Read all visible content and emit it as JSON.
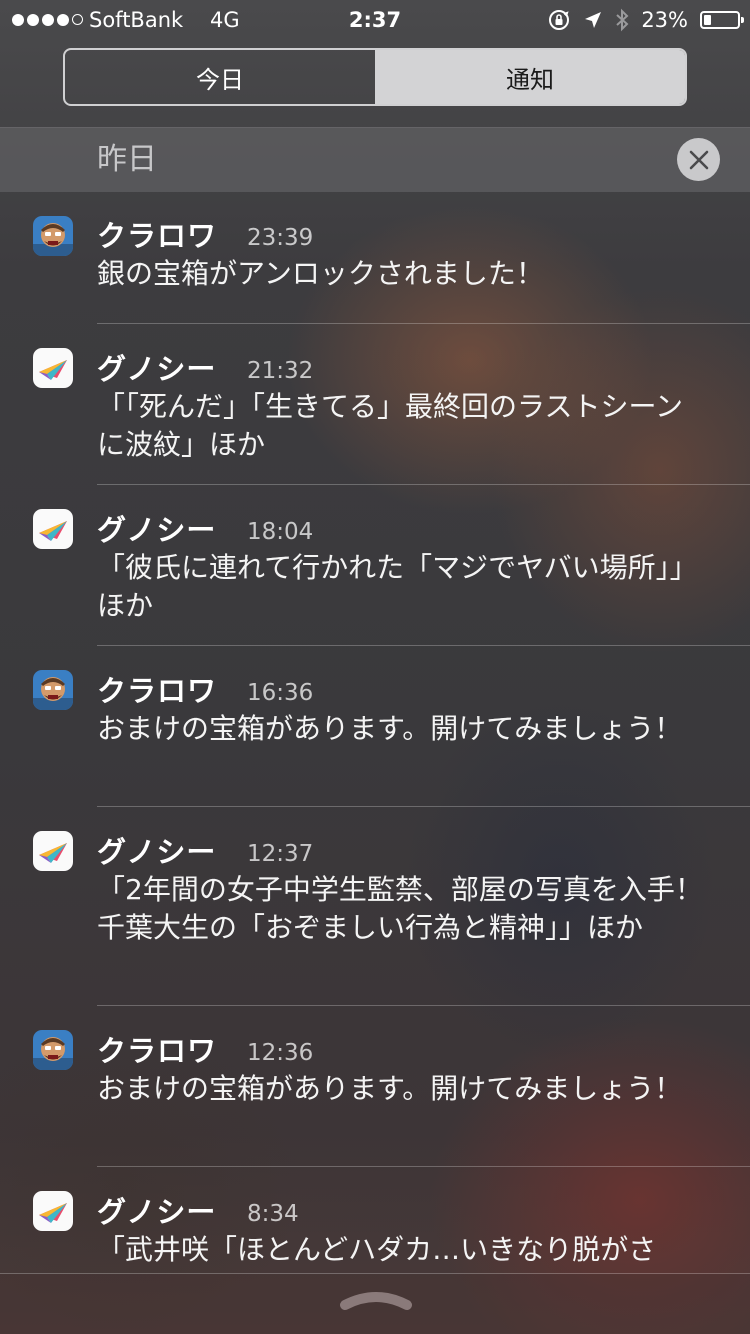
{
  "status_bar": {
    "carrier": "SoftBank",
    "network": "4G",
    "time": "2:37",
    "battery_percent_text": "23%",
    "battery_level": 0.23,
    "signal_bars_filled": 4,
    "signal_bars_total": 5
  },
  "tabs": {
    "today_label": "今日",
    "notifications_label": "通知",
    "selected": "通知"
  },
  "section": {
    "title": "昨日"
  },
  "notifications": [
    {
      "app": "クラロワ",
      "icon": "clash-royale-icon",
      "time": "23:39",
      "message": "銀の宝箱がアンロックされました！"
    },
    {
      "app": "グノシー",
      "icon": "gunosy-icon",
      "time": "21:32",
      "message": "「「死んだ」「生きてる」最終回のラストシーンに波紋」ほか"
    },
    {
      "app": "グノシー",
      "icon": "gunosy-icon",
      "time": "18:04",
      "message": "「彼氏に連れて行かれた「マジでヤバい場所」」ほか"
    },
    {
      "app": "クラロワ",
      "icon": "clash-royale-icon",
      "time": "16:36",
      "message": "おまけの宝箱があります。開けてみましょう！"
    },
    {
      "app": "グノシー",
      "icon": "gunosy-icon",
      "time": "12:37",
      "message": "「2年間の女子中学生監禁、部屋の写真を入手！千葉大生の「おぞましい行為と精神」」ほか"
    },
    {
      "app": "クラロワ",
      "icon": "clash-royale-icon",
      "time": "12:36",
      "message": "おまけの宝箱があります。開けてみましょう！"
    },
    {
      "app": "グノシー",
      "icon": "gunosy-icon",
      "time": "8:34",
      "message": "「武井咲「ほとんどハダカ…いきなり脱がさ"
    }
  ],
  "colors": {
    "segment_active_bg": "#d3d3d5",
    "section_header_bg": "#5f5f62",
    "clear_button_bg": "#c9c9cb"
  }
}
